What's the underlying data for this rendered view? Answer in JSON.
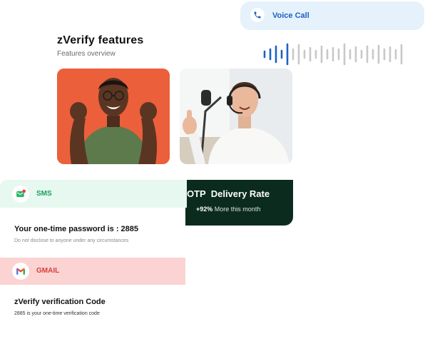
{
  "header": {
    "title": "zVerify features",
    "subtitle": "Features overview"
  },
  "voice_call": {
    "label": "Voice Call",
    "icon": "phone-icon",
    "accent": "#1b62c4",
    "bg": "#e5f1fb"
  },
  "photos": [
    {
      "name": "photo-happy-man",
      "bg": "#ec5f3b"
    },
    {
      "name": "photo-support-agent",
      "bg": "#e9ecee"
    }
  ],
  "otp_card": {
    "title": "OTP  Delivery Rate",
    "change": "+92%",
    "change_caption": "More this month",
    "bg": "#0b2b1e"
  },
  "sms": {
    "label": "SMS",
    "icon": "sms-icon",
    "accent": "#18a15c",
    "message": "Your one-time password is : 2885",
    "note": "Do not disclose to anyone under any circumstances"
  },
  "gmail": {
    "label": "GMAIL",
    "icon": "gmail-icon",
    "accent": "#d8403a",
    "title": "zVerify verification Code",
    "body": "2885 is your one-time verification code"
  }
}
